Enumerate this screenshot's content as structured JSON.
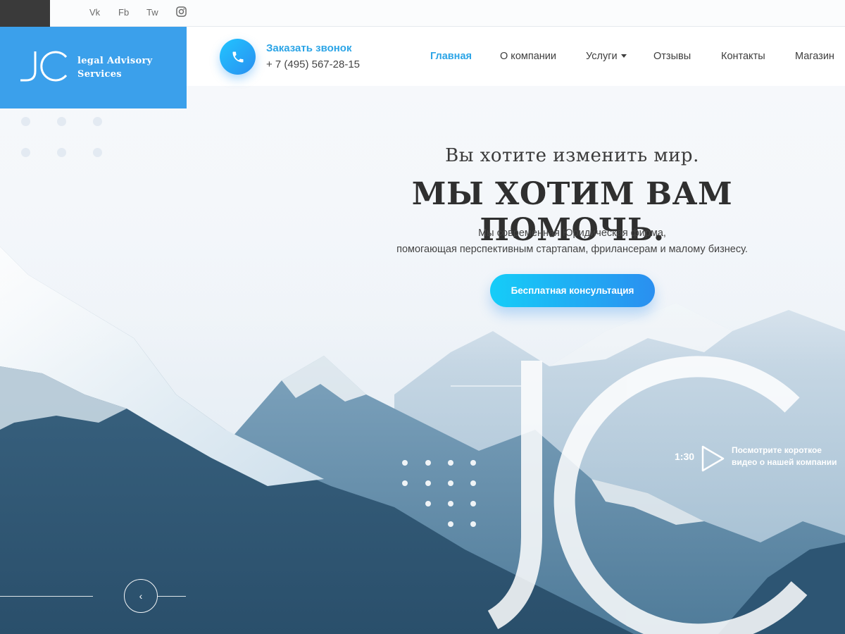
{
  "topbar": {
    "social": [
      {
        "label": "Vk"
      },
      {
        "label": "Fb"
      },
      {
        "label": "Tw"
      }
    ],
    "instagram_icon": "instagram-icon"
  },
  "logo": {
    "mark": "JC",
    "line1": "legal Advisory",
    "line2": "Services"
  },
  "header": {
    "callback_label": "Заказать звонок",
    "phone": "+ 7 (495) 567-28-15",
    "phone_icon": "phone-icon"
  },
  "nav": {
    "items": [
      {
        "label": "Главная",
        "active": true
      },
      {
        "label": "О компании"
      },
      {
        "label": "Услуги",
        "has_dropdown": true
      },
      {
        "label": "Отзывы"
      },
      {
        "label": "Контакты"
      },
      {
        "label": "Магазин"
      }
    ]
  },
  "hero": {
    "subtitle": "Вы хотите изменить мир.",
    "title": "МЫ ХОТИМ ВАМ ПОМОЧЬ.",
    "desc_line1": "Мы современная Юридическая фирма,",
    "desc_line2": "помогающая перспективным стартапам, фрилансерам и малому бизнесу.",
    "cta": "Бесплатная консультация",
    "watermark": "JC"
  },
  "video": {
    "duration": "1:30",
    "line1": "Посмотрите короткое",
    "line2": "видео о нашей компании"
  },
  "slider": {
    "prev_symbol": "‹"
  },
  "colors": {
    "accent": "#2ba4e6",
    "logo_bg": "#3ba0eb",
    "cta_start": "#15cdf8",
    "cta_end": "#2a8ff0",
    "dark_text": "#2f2f2f"
  }
}
